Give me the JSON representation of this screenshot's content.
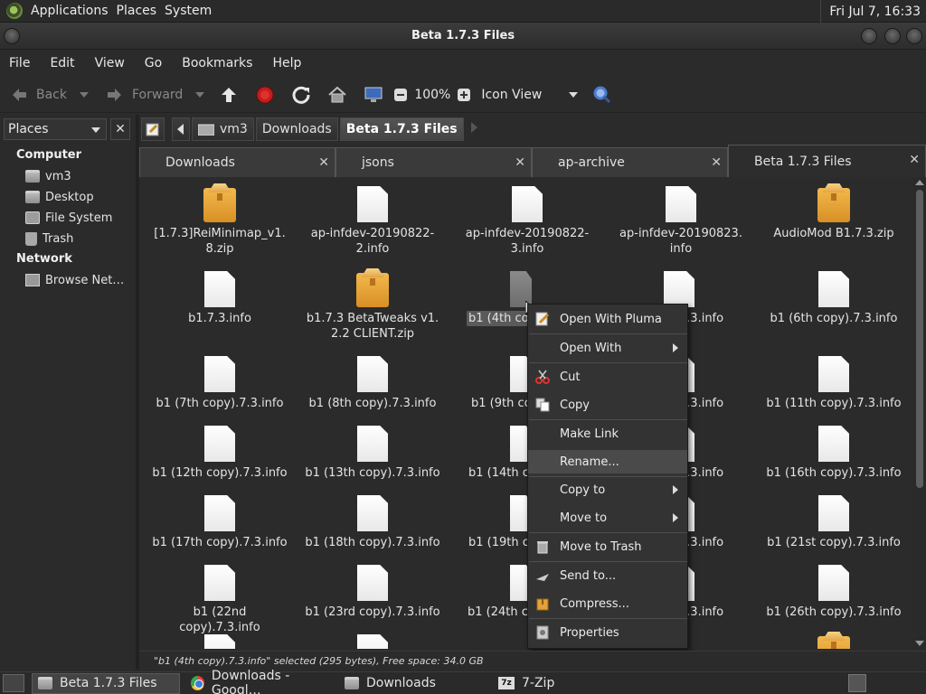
{
  "top_panel": {
    "menus": [
      "Applications",
      "Places",
      "System"
    ],
    "clock": "Fri Jul  7, 16:33"
  },
  "window": {
    "title": "Beta 1.7.3 Files"
  },
  "menubar": [
    "File",
    "Edit",
    "View",
    "Go",
    "Bookmarks",
    "Help"
  ],
  "toolbar": {
    "back": "Back",
    "forward": "Forward",
    "zoom": "100%",
    "view_mode": "Icon View"
  },
  "sidebar": {
    "selector": "Places",
    "close": "✕",
    "computer_label": "Computer",
    "network_label": "Network",
    "computer_items": [
      {
        "label": "vm3",
        "icon": "home-folder-icon"
      },
      {
        "label": "Desktop",
        "icon": "desktop-folder-icon"
      },
      {
        "label": "File System",
        "icon": "drive-icon"
      },
      {
        "label": "Trash",
        "icon": "trash-icon"
      }
    ],
    "network_items": [
      {
        "label": "Browse Net…",
        "icon": "network-icon"
      }
    ]
  },
  "location": {
    "crumbs": [
      "vm3",
      "Downloads",
      "Beta 1.7.3 Files"
    ]
  },
  "tabs": [
    {
      "label": "Downloads",
      "active": false
    },
    {
      "label": "jsons",
      "active": false
    },
    {
      "label": "ap-archive",
      "active": false
    },
    {
      "label": "Beta 1.7.3 Files",
      "active": true
    }
  ],
  "files": [
    {
      "name": "[1.7.3]ReiMinimap_v1.\n8.zip",
      "type": "zip"
    },
    {
      "name": "ap-infdev-20190822-\n2.info",
      "type": "doc"
    },
    {
      "name": "ap-infdev-20190822-\n3.info",
      "type": "doc"
    },
    {
      "name": "ap-infdev-20190823.\ninfo",
      "type": "doc"
    },
    {
      "name": "AudioMod B1.7.3.zip",
      "type": "zip"
    },
    {
      "name": "b1.7.3.info",
      "type": "doc"
    },
    {
      "name": "b1.7.3 BetaTweaks v1.\n2.2 CLIENT.zip",
      "type": "zip"
    },
    {
      "name": "b1 (4th copy).7.3.info",
      "type": "doc",
      "selected": true
    },
    {
      "name": "b1 (5th copy).7.3.info",
      "type": "doc"
    },
    {
      "name": "b1 (6th copy).7.3.info",
      "type": "doc"
    },
    {
      "name": "b1 (7th copy).7.3.info",
      "type": "doc"
    },
    {
      "name": "b1 (8th copy).7.3.info",
      "type": "doc"
    },
    {
      "name": "b1 (9th copy).7.3.info",
      "type": "doc"
    },
    {
      "name": "b1 (10th copy).7.3.info",
      "type": "doc"
    },
    {
      "name": "b1 (11th copy).7.3.info",
      "type": "doc"
    },
    {
      "name": "b1 (12th copy).7.3.info",
      "type": "doc"
    },
    {
      "name": "b1 (13th copy).7.3.info",
      "type": "doc"
    },
    {
      "name": "b1 (14th copy).7.3.info",
      "type": "doc"
    },
    {
      "name": "b1 (15th copy).7.3.info",
      "type": "doc"
    },
    {
      "name": "b1 (16th copy).7.3.info",
      "type": "doc"
    },
    {
      "name": "b1 (17th copy).7.3.info",
      "type": "doc"
    },
    {
      "name": "b1 (18th copy).7.3.info",
      "type": "doc"
    },
    {
      "name": "b1 (19th copy).7.3.info",
      "type": "doc"
    },
    {
      "name": "b1 (20th copy).7.3.info",
      "type": "doc"
    },
    {
      "name": "b1 (21st copy).7.3.info",
      "type": "doc"
    },
    {
      "name": "b1 (22nd copy).7.3.info",
      "type": "doc"
    },
    {
      "name": "b1 (23rd copy).7.3.info",
      "type": "doc"
    },
    {
      "name": "b1 (24th copy).7.3.info",
      "type": "doc"
    },
    {
      "name": "b1 (25th copy).7.3.info",
      "type": "doc"
    },
    {
      "name": "b1 (26th copy).7.3.info",
      "type": "doc"
    }
  ],
  "visible_names": {
    "sel_fragment": "b1 (4th co",
    "r3c3": "b1 (9th co",
    "r4c3": "b1 (14th co",
    "r5c3": "b1 (19th co",
    "r6c3": "b1 (24th co",
    "r2c4": "y).7.3.info",
    "r3c4": "y).7.3.info",
    "r4c4": "y).7.3.info",
    "r5c4": "y).7.3.info",
    "r6c4": "y).7.3.info"
  },
  "context_menu": [
    {
      "label": "Open With Pluma",
      "icon": "pluma-editor-icon",
      "submenu": false
    },
    {
      "label": "Open With",
      "icon": "",
      "submenu": true
    },
    {
      "label": "Cut",
      "icon": "scissors-icon",
      "submenu": false
    },
    {
      "label": "Copy",
      "icon": "copy-icon",
      "submenu": false
    },
    {
      "label": "Make Link",
      "icon": "",
      "submenu": false
    },
    {
      "label": "Rename...",
      "icon": "",
      "submenu": false,
      "hover": true
    },
    {
      "label": "Copy to",
      "icon": "",
      "submenu": true
    },
    {
      "label": "Move to",
      "icon": "",
      "submenu": true
    },
    {
      "label": "Move to Trash",
      "icon": "trash-icon",
      "submenu": false
    },
    {
      "label": "Send to...",
      "icon": "send-icon",
      "submenu": false
    },
    {
      "label": "Compress...",
      "icon": "archive-icon",
      "submenu": false
    },
    {
      "label": "Properties",
      "icon": "properties-icon",
      "submenu": false
    }
  ],
  "statusbar": "\"b1 (4th copy).7.3.info\" selected (295 bytes), Free space: 34.0 GB",
  "taskbar": [
    {
      "label": "Beta 1.7.3 Files",
      "icon": "folder-icon",
      "active": true
    },
    {
      "label": "Downloads - Googl…",
      "icon": "chrome-icon",
      "active": false
    },
    {
      "label": "Downloads",
      "icon": "folder-icon",
      "active": false
    },
    {
      "label": "7-Zip",
      "icon": "7zip-icon",
      "active": false
    }
  ],
  "taskbar_7zip_badge": "7z"
}
